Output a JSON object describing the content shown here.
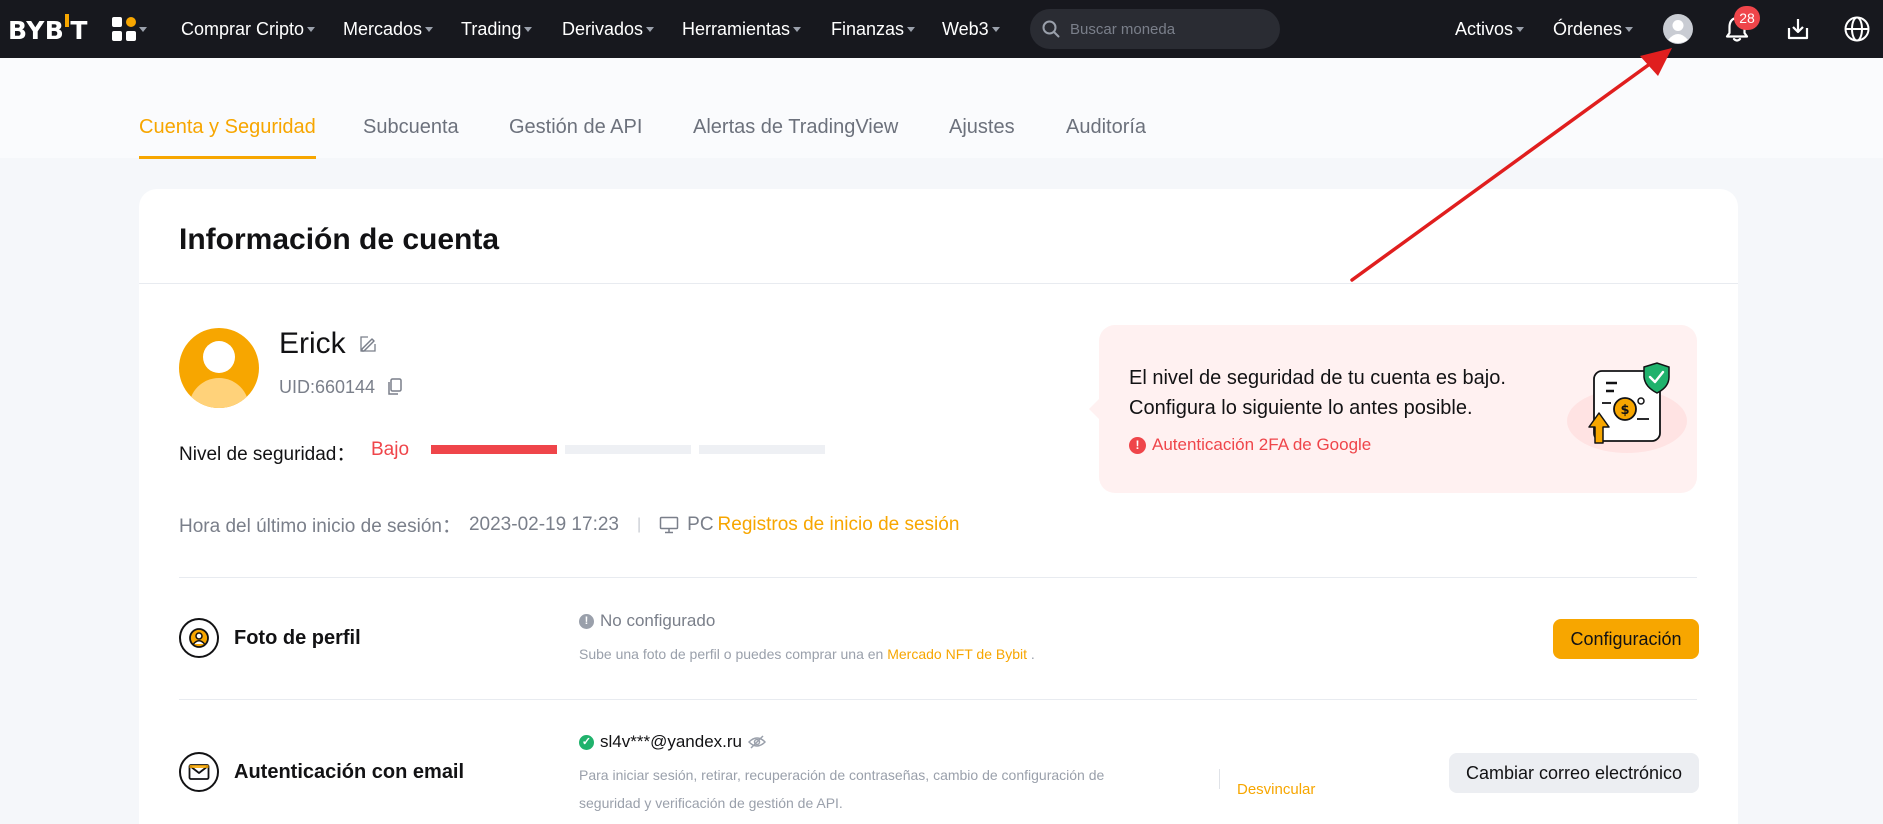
{
  "topbar": {
    "logo": "BYBIT",
    "nav": [
      {
        "label": "Comprar Cripto"
      },
      {
        "label": "Mercados"
      },
      {
        "label": "Trading"
      },
      {
        "label": "Derivados"
      },
      {
        "label": "Herramientas"
      },
      {
        "label": "Finanzas"
      },
      {
        "label": "Web3"
      }
    ],
    "search_placeholder": "Buscar moneda",
    "right_nav": [
      {
        "label": "Activos"
      },
      {
        "label": "Órdenes"
      }
    ],
    "notification_count": "28",
    "icons": [
      "grid-apps-icon",
      "search-icon",
      "user-icon",
      "bell-icon",
      "download-icon",
      "globe-icon"
    ]
  },
  "tabs": [
    {
      "label": "Cuenta y Seguridad",
      "active": true
    },
    {
      "label": "Subcuenta"
    },
    {
      "label": "Gestión de API"
    },
    {
      "label": "Alertas de TradingView"
    },
    {
      "label": "Ajustes"
    },
    {
      "label": "Auditoría"
    }
  ],
  "account": {
    "title": "Información de cuenta",
    "username": "Erick",
    "uid": "UID:660144",
    "security_label": "Nivel de seguridad：",
    "security_value": "Bajo",
    "security_level": {
      "filled": 1,
      "total": 3
    },
    "last_login_label": "Hora del último inicio de sesión：",
    "last_login_time": "2023-02-19 17:23",
    "device": "PC",
    "login_records_link": "Registros de inicio de sesión"
  },
  "alert": {
    "line1": "El nivel de seguridad de tu cuenta es bajo.",
    "line2": "Configura lo siguiente lo antes posible.",
    "item": "Autenticación 2FA de Google"
  },
  "rows": [
    {
      "title": "Foto de perfil",
      "status": "No configurado",
      "desc_before": "Sube una foto de perfil o puedes comprar una en ",
      "desc_link": "Mercado NFT de Bybit",
      "desc_after": " .",
      "button": "Configuración"
    },
    {
      "title": "Autenticación con email",
      "status": "sl4v***@yandex.ru",
      "desc_line1": "Para iniciar sesión, retirar, recuperación de contraseñas, cambio de configuración de",
      "desc_line2": "seguridad y verificación de gestión de API.",
      "unlink": "Desvincular",
      "button": "Cambiar correo electrónico"
    }
  ],
  "colors": {
    "accent": "#f7a600",
    "danger": "#ef454a",
    "success": "#20b26c",
    "topbar": "#17181e"
  }
}
